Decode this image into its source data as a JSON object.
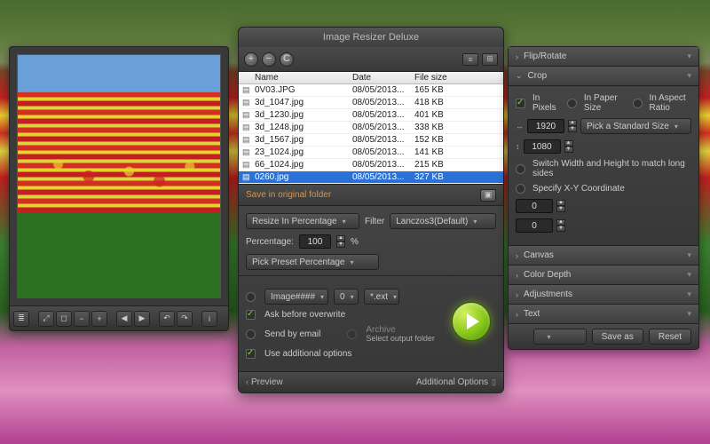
{
  "app_title": "Image Resizer Deluxe",
  "file_table": {
    "columns": [
      "Name",
      "Date",
      "File size"
    ],
    "rows": [
      {
        "name": "0V03.JPG",
        "date": "08/05/2013...",
        "size": "165 KB",
        "selected": false
      },
      {
        "name": "3d_1047.jpg",
        "date": "08/05/2013...",
        "size": "418 KB",
        "selected": false
      },
      {
        "name": "3d_1230.jpg",
        "date": "08/05/2013...",
        "size": "401 KB",
        "selected": false
      },
      {
        "name": "3d_1248.jpg",
        "date": "08/05/2013...",
        "size": "338 KB",
        "selected": false
      },
      {
        "name": "3d_1567.jpg",
        "date": "08/05/2013...",
        "size": "152 KB",
        "selected": false
      },
      {
        "name": "23_1024.jpg",
        "date": "08/05/2013...",
        "size": "141 KB",
        "selected": false
      },
      {
        "name": "66_1024.jpg",
        "date": "08/05/2013...",
        "size": "215 KB",
        "selected": false
      },
      {
        "name": "0260.jpg",
        "date": "08/05/2013...",
        "size": "327 KB",
        "selected": true
      }
    ]
  },
  "save": {
    "label": "Save in original folder",
    "browse_tooltip": "Browse"
  },
  "resize": {
    "mode_label": "Resize In Percentage",
    "filter_label": "Filter",
    "filter_value": "Lanczos3(Default)",
    "percentage_label": "Percentage:",
    "percentage_value": "100",
    "percent_sign": "%",
    "preset_label": "Pick Preset Percentage"
  },
  "output": {
    "name_radio": "Image####",
    "seq_value": "0",
    "ext_value": "*.ext",
    "ask_label": "Ask before overwrite",
    "send_label": "Send by email",
    "archive_label": "Archive",
    "archive_note": "Select output folder",
    "additional_label": "Use additional options"
  },
  "bottom": {
    "preview": "Preview",
    "additional": "Additional Options"
  },
  "options": {
    "sections": {
      "flip": "Flip/Rotate",
      "crop": "Crop",
      "canvas": "Canvas",
      "color": "Color Depth",
      "adjust": "Adjustments",
      "text": "Text"
    },
    "crop": {
      "mode_pixels": "In Pixels",
      "mode_paper": "In Paper Size",
      "mode_aspect": "In Aspect Ratio",
      "width_value": "1920",
      "height_value": "1080",
      "std_size_label": "Pick a Standard Size",
      "switch_label": "Switch Width and Height to match long sides",
      "specify_label": "Specify X-Y Coordinate",
      "x_value": "0",
      "y_value": "0"
    },
    "footer": {
      "save_as": "Save as",
      "reset": "Reset"
    }
  },
  "icons": {
    "add": "+",
    "remove": "−",
    "clear": "C",
    "list": "≡",
    "grid": "⊞",
    "folder": "▣",
    "play": "▶",
    "chev_left": "‹",
    "chev_down": "⌄",
    "chev_right": "›"
  }
}
